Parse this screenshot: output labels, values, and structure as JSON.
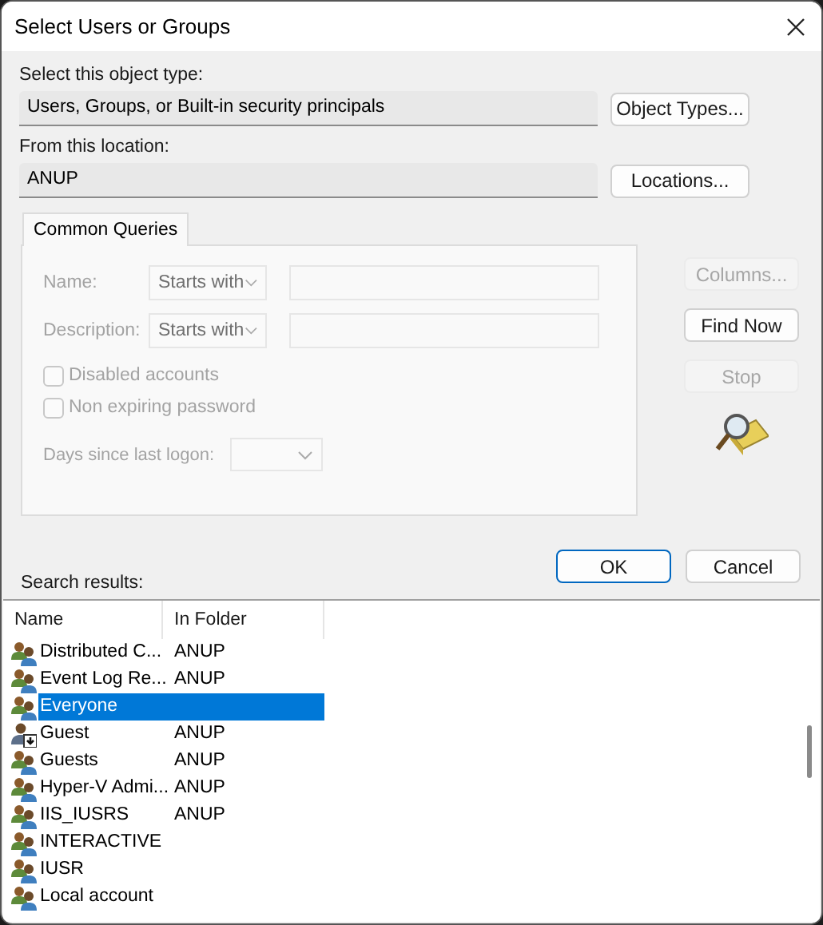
{
  "window": {
    "title": "Select Users or Groups"
  },
  "object_type": {
    "label": "Select this object type:",
    "value": "Users, Groups, or Built-in security principals",
    "button": "Object Types..."
  },
  "location": {
    "label": "From this location:",
    "value": "ANUP",
    "button": "Locations..."
  },
  "tabs": [
    {
      "label": "Common Queries",
      "selected": true
    }
  ],
  "queries": {
    "disabled": true,
    "fields": [
      {
        "label": "Name:",
        "operator": "Starts with"
      },
      {
        "label": "Description:",
        "operator": "Starts with"
      }
    ],
    "checkboxes": [
      {
        "label": "Disabled accounts",
        "checked": false
      },
      {
        "label": "Non expiring password",
        "checked": false
      }
    ],
    "days": {
      "label": "Days since last logon:"
    }
  },
  "side_buttons": [
    {
      "label": "Columns...",
      "disabled": true
    },
    {
      "label": "Find Now",
      "disabled": false
    },
    {
      "label": "Stop",
      "disabled": true
    }
  ],
  "dialog_buttons": [
    {
      "label": "OK",
      "default": true
    },
    {
      "label": "Cancel",
      "default": false
    }
  ],
  "results": {
    "label": "Search results:",
    "columns": [
      "Name",
      "In Folder"
    ],
    "rows": [
      {
        "name": "Distributed C...",
        "folder": "ANUP",
        "kind": "group",
        "selected": false
      },
      {
        "name": "Event Log Re...",
        "folder": "ANUP",
        "kind": "group",
        "selected": false
      },
      {
        "name": "Everyone",
        "kind": "group",
        "selected": true
      },
      {
        "name": "Guest",
        "folder": "ANUP",
        "kind": "user",
        "selected": false
      },
      {
        "name": "Guests",
        "folder": "ANUP",
        "kind": "group",
        "selected": false
      },
      {
        "name": "Hyper-V Admi...",
        "folder": "ANUP",
        "kind": "group",
        "selected": false
      },
      {
        "name": "IIS_IUSRS",
        "folder": "ANUP",
        "kind": "group",
        "selected": false
      },
      {
        "name": "INTERACTIVE",
        "kind": "group",
        "selected": false
      },
      {
        "name": "IUSR",
        "kind": "group",
        "selected": false
      },
      {
        "name": "Local account",
        "kind": "group",
        "selected": false
      }
    ]
  }
}
